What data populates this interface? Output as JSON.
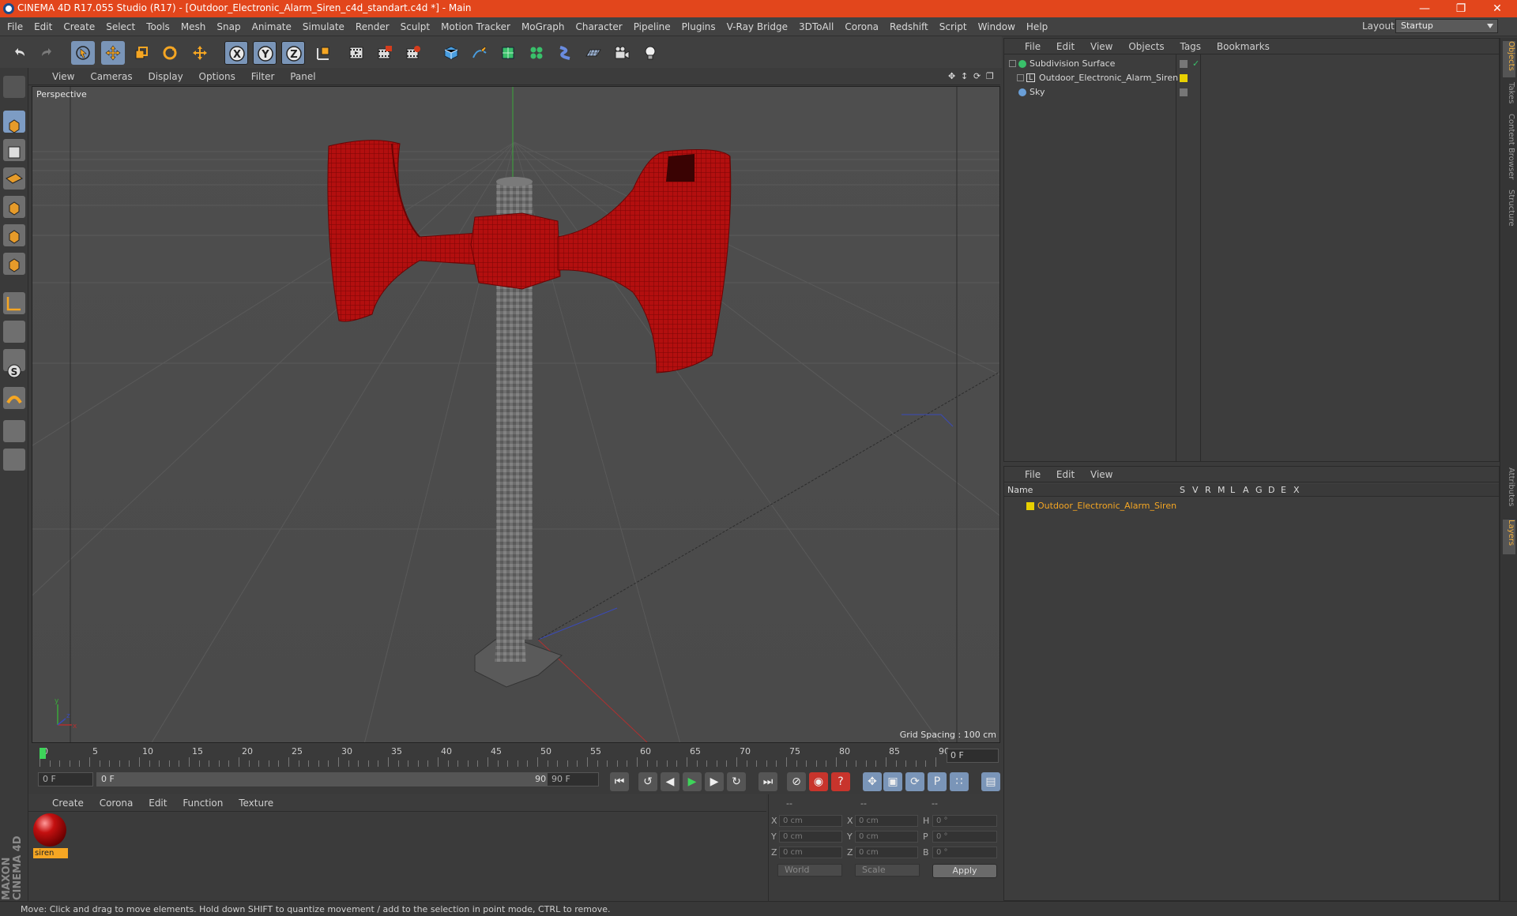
{
  "window": {
    "title": "CINEMA 4D R17.055 Studio (R17) - [Outdoor_Electronic_Alarm_Siren_c4d_standart.c4d *] - Main",
    "min_icon": "minimize-icon",
    "max_icon": "restore-icon",
    "close_icon": "close-icon"
  },
  "menubar": {
    "items": [
      "File",
      "Edit",
      "Create",
      "Select",
      "Tools",
      "Mesh",
      "Snap",
      "Animate",
      "Simulate",
      "Render",
      "Sculpt",
      "Motion Tracker",
      "MoGraph",
      "Character",
      "Pipeline",
      "Plugins",
      "V-Ray Bridge",
      "3DToAll",
      "Corona",
      "Redshift",
      "Script",
      "Window",
      "Help"
    ],
    "layout_label": "Layout:",
    "layout_value": "Startup"
  },
  "toolbar": {
    "icons": [
      "undo-icon",
      "redo-icon",
      "select-live-icon",
      "move-icon",
      "scale-icon",
      "rotate-icon",
      "move-recent-icon",
      "x-axis-icon",
      "y-axis-icon",
      "z-axis-icon",
      "coordinate-system-icon",
      "render-view-icon",
      "render-picture-viewer-icon",
      "render-settings-icon",
      "cube-icon",
      "pen-spline-icon",
      "subdivision-icon",
      "cloner-icon",
      "deformer-icon",
      "floor-icon",
      "camera-icon",
      "light-icon"
    ],
    "axis_labels": [
      "X",
      "Y",
      "Z"
    ]
  },
  "lefttools": {
    "icons": [
      "model-mode-icon",
      "object-mode-icon",
      "texture-mode-icon",
      "workplane-icon",
      "points-mode-icon",
      "edges-mode-icon",
      "polygons-mode-icon",
      "axis-icon",
      "tweak-icon",
      "solo-icon",
      "magnet-icon",
      "snap-grid-icon",
      "snap-settings-icon"
    ]
  },
  "viewport": {
    "menu": [
      "View",
      "Cameras",
      "Display",
      "Options",
      "Filter",
      "Panel"
    ],
    "label": "Perspective",
    "grid_spacing": "Grid Spacing : 100 cm",
    "nav_icons": [
      "pan-icon",
      "zoom-icon",
      "orbit-icon",
      "maximize-icon"
    ],
    "axis_gizmo": [
      "x",
      "y",
      "z"
    ]
  },
  "timeline": {
    "ticks": [
      "0",
      "5",
      "10",
      "15",
      "20",
      "25",
      "30",
      "35",
      "40",
      "45",
      "50",
      "55",
      "60",
      "65",
      "70",
      "75",
      "80",
      "85",
      "90"
    ],
    "current_frame": "0 F",
    "start_field": "0 F",
    "range_start": "0 F",
    "range_end": "90 F",
    "end_field": "90 F",
    "transport_icons": [
      "go-start-icon",
      "prev-key-icon",
      "prev-frame-icon",
      "play-icon",
      "next-frame-icon",
      "next-key-icon",
      "go-end-icon",
      "record-off-icon",
      "record-icon",
      "autokey-icon",
      "move-key-icon",
      "scale-key-icon",
      "rotate-key-icon",
      "param-key-icon",
      "pla-key-icon",
      "timeline-icon"
    ]
  },
  "materials": {
    "menu": [
      "Create",
      "Corona",
      "Edit",
      "Function",
      "Texture"
    ],
    "items": [
      {
        "name": "siren"
      }
    ]
  },
  "coordinates": {
    "headers": [
      "--",
      "--",
      "--"
    ],
    "rows": [
      {
        "a_label": "X",
        "a_value": "0 cm",
        "b_label": "X",
        "b_value": "0 cm",
        "c_label": "H",
        "c_value": "0 °"
      },
      {
        "a_label": "Y",
        "a_value": "0 cm",
        "b_label": "Y",
        "b_value": "0 cm",
        "c_label": "P",
        "c_value": "0 °"
      },
      {
        "a_label": "Z",
        "a_value": "0 cm",
        "b_label": "Z",
        "b_value": "0 cm",
        "c_label": "B",
        "c_value": "0 °"
      }
    ],
    "mode_world": "World",
    "mode_scale": "Scale",
    "apply": "Apply"
  },
  "status": "Move: Click and drag to move elements. Hold down SHIFT to quantize movement / add to the selection in point mode, CTRL to remove.",
  "object_manager": {
    "menu": [
      "File",
      "Edit",
      "View",
      "Objects",
      "Tags",
      "Bookmarks"
    ],
    "objects": [
      {
        "name": "Subdivision Surface",
        "icon": "subdivision-icon"
      },
      {
        "name": "Outdoor_Electronic_Alarm_Siren",
        "icon": "null-object-icon"
      },
      {
        "name": "Sky",
        "icon": "sky-icon"
      }
    ]
  },
  "layer_manager": {
    "menu": [
      "File",
      "Edit",
      "View"
    ],
    "columns": [
      "Name",
      "S",
      "V",
      "R",
      "M",
      "L",
      "A",
      "G",
      "D",
      "E",
      "X"
    ],
    "layers": [
      {
        "name": "Outdoor_Electronic_Alarm_Siren",
        "color": "#e8d000"
      }
    ]
  },
  "side_tabs": [
    "Objects",
    "Takes",
    "Content Browser",
    "Structure",
    "Attributes",
    "Layers"
  ],
  "colors": {
    "titlebar": "#e2461c",
    "accent_orange": "#f5a623",
    "selected_blue": "#7a95b8",
    "siren_red": "#b01010"
  },
  "branding": "MAXON CINEMA 4D"
}
